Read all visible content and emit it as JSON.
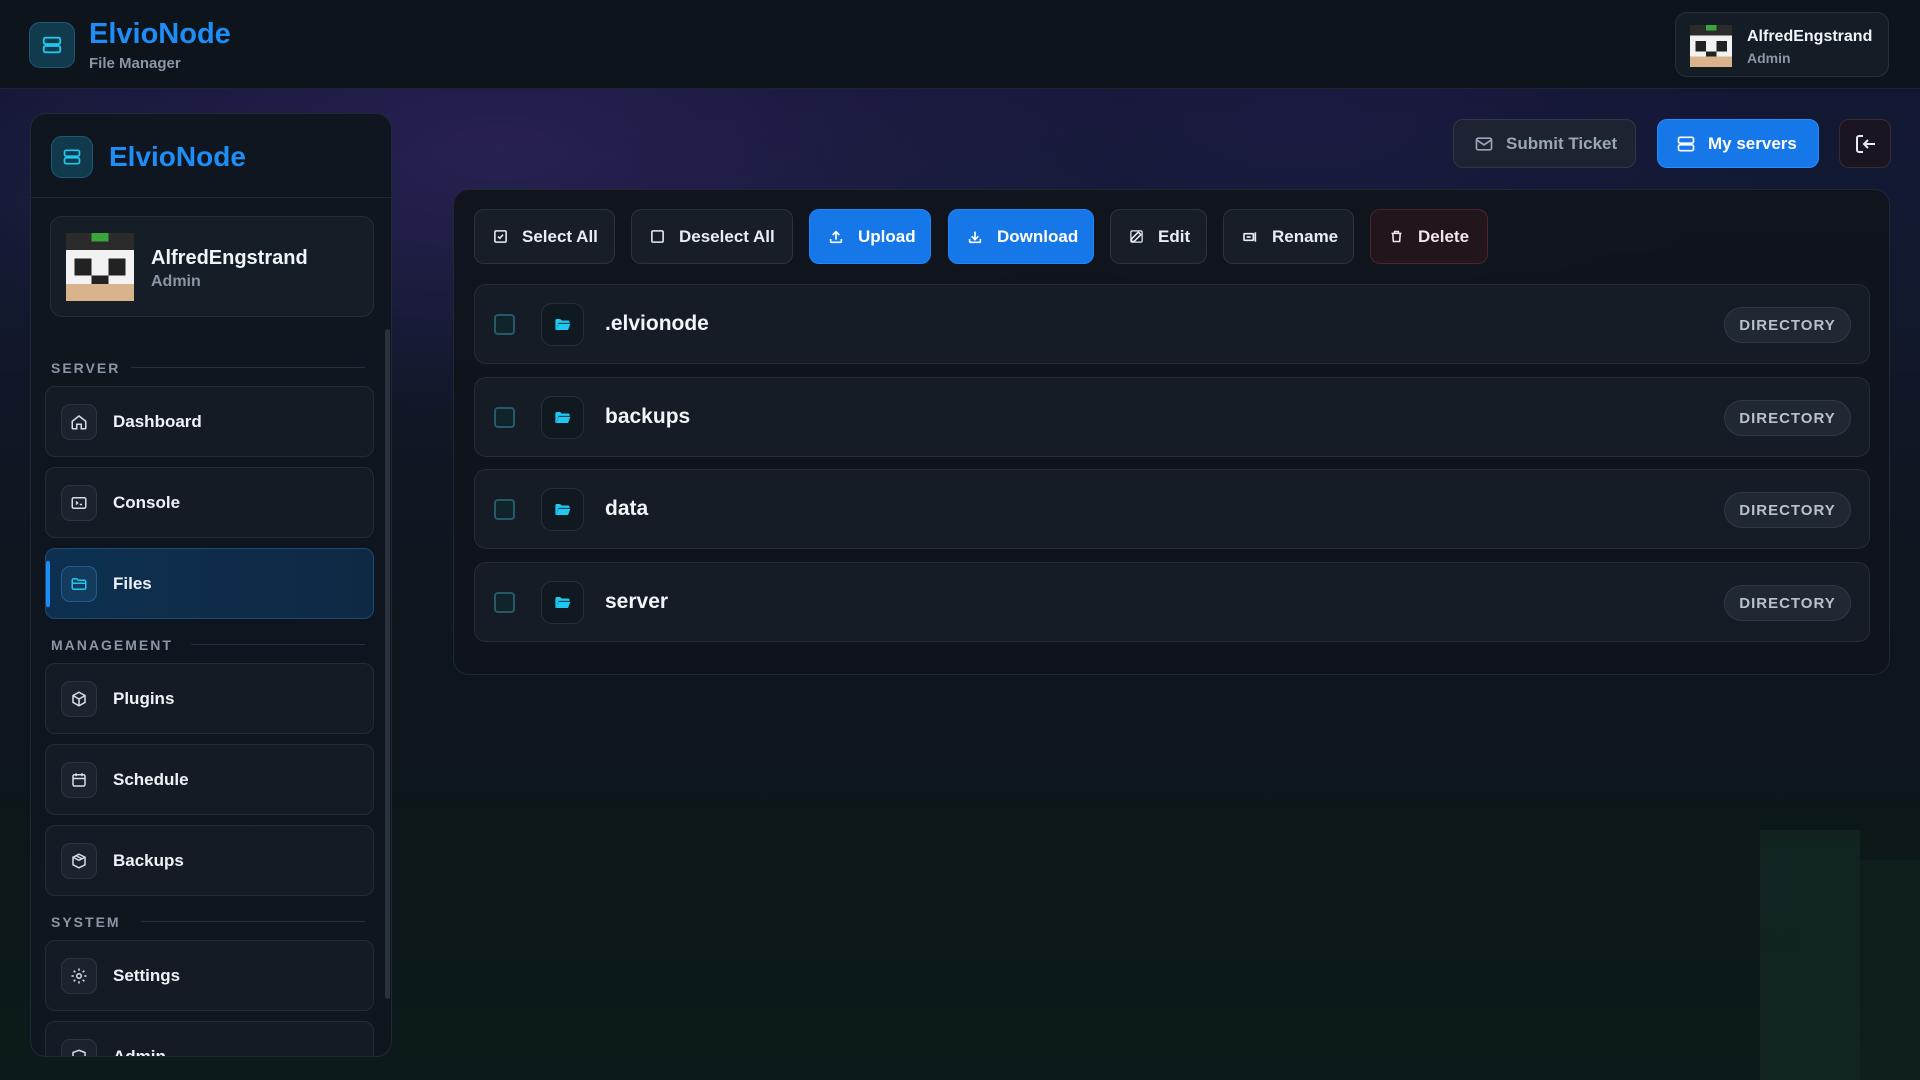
{
  "header": {
    "brand": "ElvioNode",
    "subtitle": "File Manager",
    "user": {
      "name": "AlfredEngstrand",
      "role": "Admin"
    }
  },
  "sidebar": {
    "brand": "ElvioNode",
    "user": {
      "name": "AlfredEngstrand",
      "role": "Admin"
    },
    "sections": [
      {
        "label": "SERVER"
      },
      {
        "label": "MANAGEMENT"
      },
      {
        "label": "SYSTEM"
      }
    ],
    "items": [
      {
        "label": "Dashboard",
        "icon": "home-icon"
      },
      {
        "label": "Console",
        "icon": "terminal-icon"
      },
      {
        "label": "Files",
        "icon": "folder-icon",
        "active": true
      },
      {
        "label": "Plugins",
        "icon": "cube-icon"
      },
      {
        "label": "Schedule",
        "icon": "calendar-icon"
      },
      {
        "label": "Backups",
        "icon": "box-icon"
      },
      {
        "label": "Settings",
        "icon": "gear-icon"
      },
      {
        "label": "Admin",
        "icon": "shield-icon"
      }
    ]
  },
  "actions": {
    "submit_ticket": "Submit Ticket",
    "my_servers": "My servers",
    "logout": "logout-icon"
  },
  "toolbar": {
    "select_all": "Select All",
    "deselect_all": "Deselect All",
    "upload": "Upload",
    "download": "Download",
    "edit": "Edit",
    "rename": "Rename",
    "delete": "Delete"
  },
  "files": [
    {
      "name": ".elvionode",
      "type": "DIRECTORY"
    },
    {
      "name": "backups",
      "type": "DIRECTORY"
    },
    {
      "name": "data",
      "type": "DIRECTORY"
    },
    {
      "name": "server",
      "type": "DIRECTORY"
    }
  ],
  "colors": {
    "accent": "#1e8df5",
    "primary_button": "#1677e8",
    "folder_icon": "#1ec8f0",
    "background": "#0c1118"
  }
}
